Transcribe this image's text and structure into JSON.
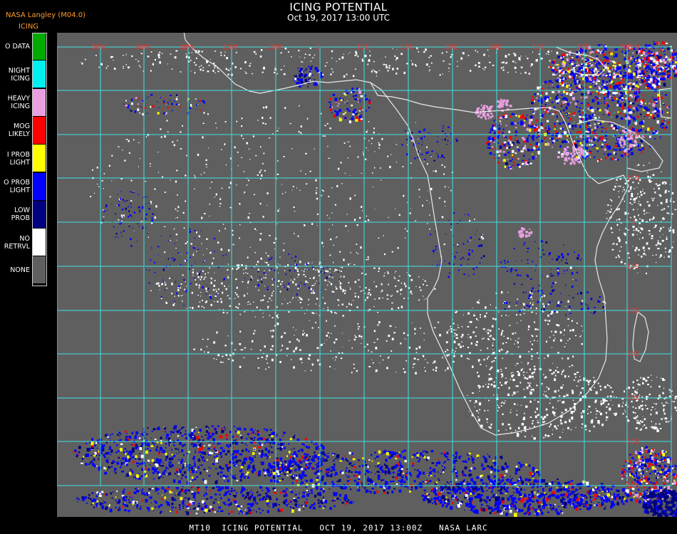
{
  "header": {
    "source": "NASA Langley (M04.0)",
    "product": "ICING",
    "title": "ICING POTENTIAL",
    "timestamp": "Oct 19, 2017 13:00 UTC"
  },
  "legend": [
    {
      "label_lines": [
        "O DATA"
      ],
      "color": "#00aa00"
    },
    {
      "label_lines": [
        "NIGHT",
        "ICING"
      ],
      "color": "#00f0f0"
    },
    {
      "label_lines": [
        "HEAVY",
        "ICING"
      ],
      "color": "#e8a0e0"
    },
    {
      "label_lines": [
        "MOG",
        "LIKELY"
      ],
      "color": "#ff0000"
    },
    {
      "label_lines": [
        "I PROB",
        "LIGHT"
      ],
      "color": "#ffff00"
    },
    {
      "label_lines": [
        "O PROB",
        "LIGHT"
      ],
      "color": "#0000ff"
    },
    {
      "label_lines": [
        "LOW",
        "PROB"
      ],
      "color": "#000080"
    },
    {
      "label_lines": [
        "NO",
        "RETRVL"
      ],
      "color": "#ffffff"
    },
    {
      "label_lines": [
        "NONE"
      ],
      "color": "#5f5f5f"
    }
  ],
  "map": {
    "background": "#5f5f5f",
    "grid_color": "#40e0e0",
    "coastline_color": "#e8e8e8",
    "grid_label_color": "#ff3030",
    "longitude_labels": [
      "50W",
      "40W",
      "30W",
      "20W",
      "10W",
      "0",
      "10E",
      "20E",
      "30E",
      "40E",
      "50E",
      "60E",
      "70E"
    ],
    "latitude_labels": [
      "40N",
      "30N",
      "20N",
      "10N",
      "0",
      "10S",
      "20S",
      "30S",
      "40S",
      "50S",
      "60S"
    ]
  },
  "footer": {
    "text": "MT10  ICING POTENTIAL   OCT 19, 2017 13:00Z   NASA LARC"
  }
}
